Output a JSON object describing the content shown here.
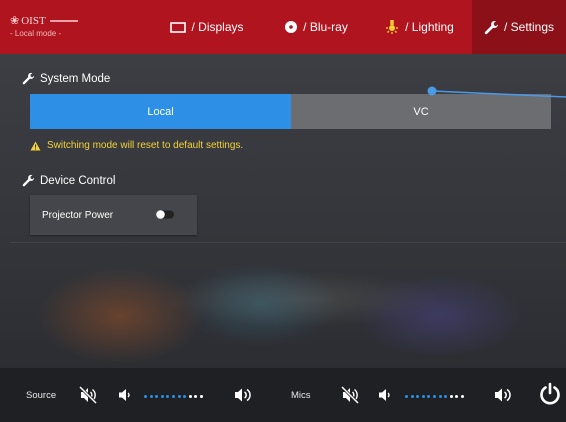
{
  "header": {
    "logo_name": "OIST",
    "logo_subtitle": "- Local mode -",
    "tabs": [
      {
        "id": "displays",
        "label": "/ Displays",
        "icon": "display-icon",
        "active": false
      },
      {
        "id": "bluray",
        "label": "/ Blu-ray",
        "icon": "disc-icon",
        "active": false
      },
      {
        "id": "lighting",
        "label": "/ Lighting",
        "icon": "light-icon",
        "active": false
      },
      {
        "id": "settings",
        "label": "/ Settings",
        "icon": "wrench-icon",
        "active": true
      }
    ]
  },
  "system_mode": {
    "title": "System Mode",
    "options": [
      "Local",
      "VC"
    ],
    "selected": "Local",
    "warning": "Switching mode will reset to default settings."
  },
  "device_control": {
    "title": "Device Control",
    "projector_power_label": "Projector Power",
    "projector_power_on": false
  },
  "footer": {
    "source_label": "Source",
    "mics_label": "Mics",
    "source_level_dots_filled": 8,
    "source_level_dots_total": 11,
    "mics_level_dots_filled": 8,
    "mics_level_dots_total": 11,
    "power_icon": "power-icon"
  },
  "colors": {
    "header_red": "#b0141e",
    "active_tab": "#8c1018",
    "selected_blue": "#2d8fe6",
    "warning_yellow": "#f2d23a",
    "level_blue": "#2d8fe6"
  }
}
